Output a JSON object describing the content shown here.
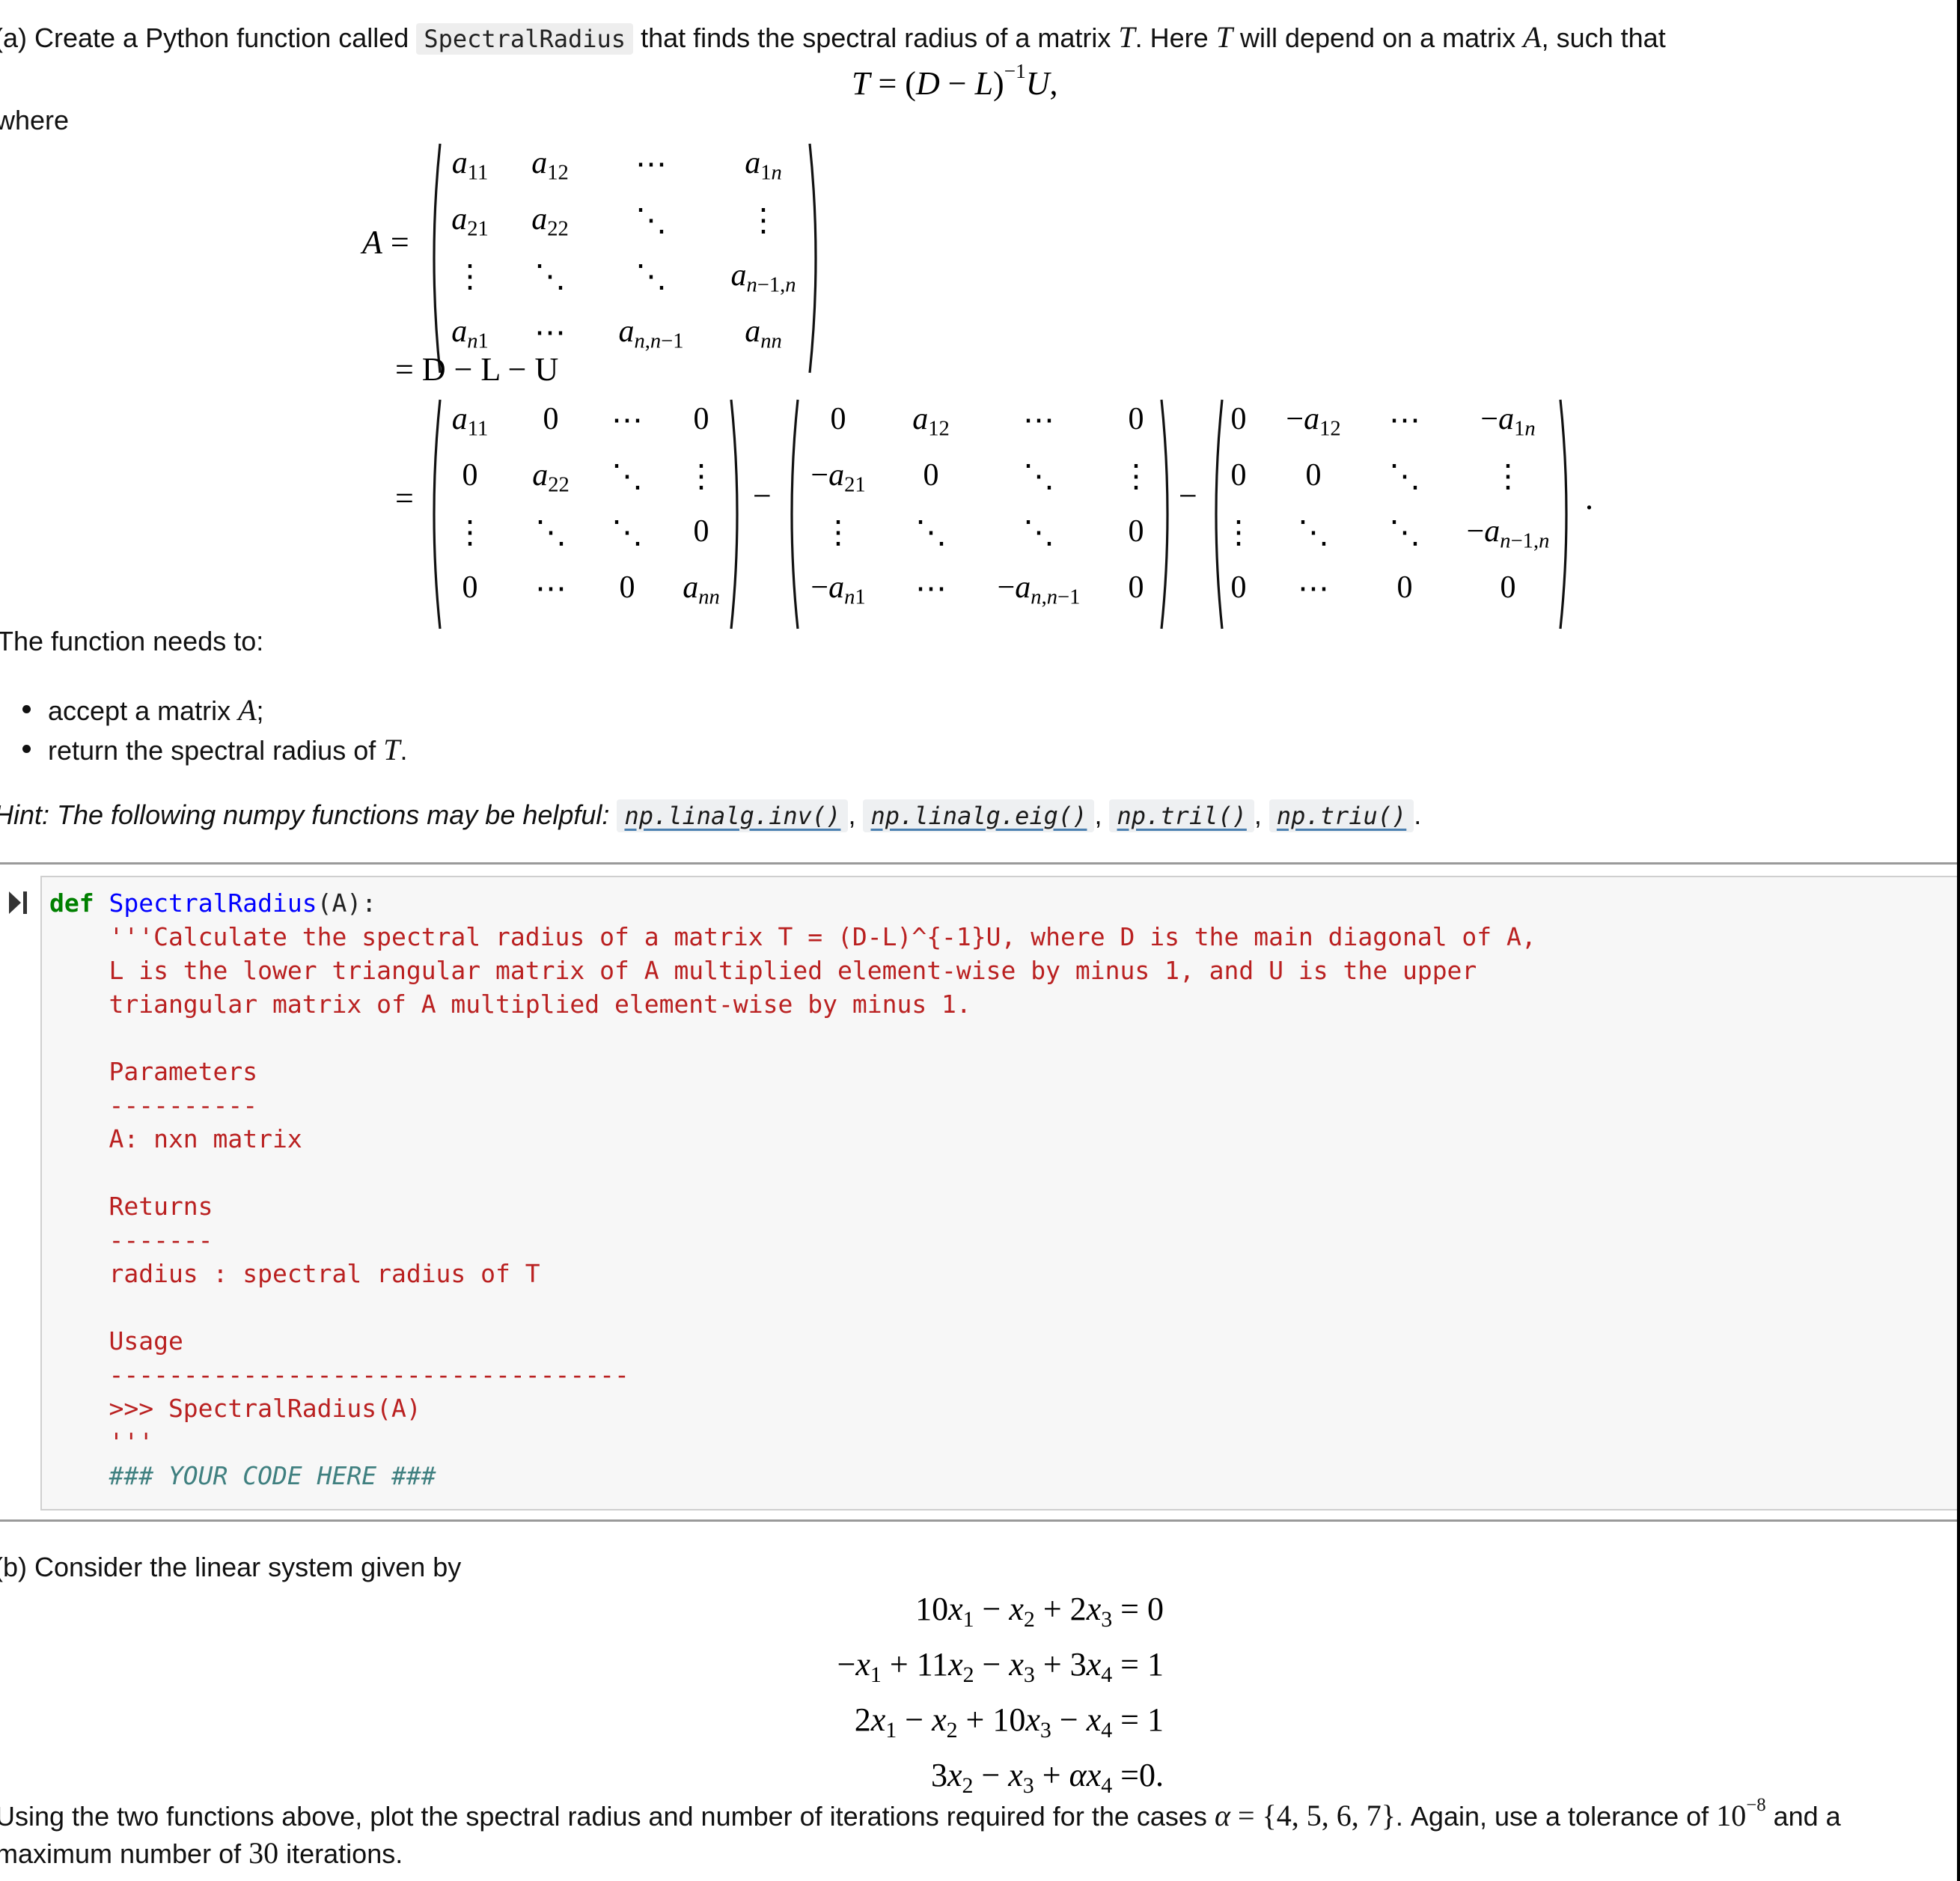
{
  "part_a": {
    "intro_before_code": "(a) Create a Python function called",
    "function_name_code": "SpectralRadius",
    "intro_after_code_1": "that finds the spectral radius of a matrix",
    "T": "T",
    "intro_after_code_2": ". Here",
    "intro_after_code_3": "will depend on a matrix",
    "A": "A",
    "intro_after_code_4": ", such that",
    "formula_T": {
      "lhs": "T",
      "eq": " = (",
      "D": "D",
      "minus": " − ",
      "L": "L",
      "close": ")",
      "exp": "−1",
      "U": "U",
      "end": ","
    },
    "where_label": "where",
    "matrix_A": {
      "label": "A",
      "eq": "=",
      "rows": [
        [
          "a11",
          "a12",
          "⋯",
          "a1n"
        ],
        [
          "a21",
          "a22",
          "⋱",
          "⋮"
        ],
        [
          "⋮",
          "⋱",
          "⋱",
          "an-1,n"
        ],
        [
          "an1",
          "⋯",
          "an,n-1",
          "ann"
        ]
      ]
    },
    "decomposition_line": "= D − L − U",
    "matrix_D": {
      "rows": [
        [
          "a11",
          "0",
          "⋯",
          "0"
        ],
        [
          "0",
          "a22",
          "⋱",
          "⋮"
        ],
        [
          "⋮",
          "⋱",
          "⋱",
          "0"
        ],
        [
          "0",
          "⋯",
          "0",
          "ann"
        ]
      ]
    },
    "matrix_L_neg": {
      "rows": [
        [
          "0",
          "a12",
          "⋯",
          "0"
        ],
        [
          "−a21",
          "0",
          "⋱",
          "⋮"
        ],
        [
          "⋮",
          "⋱",
          "⋱",
          "0"
        ],
        [
          "−an1",
          "⋯",
          "−an,n-1",
          "0"
        ]
      ]
    },
    "matrix_U_neg": {
      "rows": [
        [
          "0",
          "−a12",
          "⋯",
          "−a1n"
        ],
        [
          "0",
          "0",
          "⋱",
          "⋮"
        ],
        [
          "⋮",
          "⋱",
          "⋱",
          "−an-1,n"
        ],
        [
          "0",
          "⋯",
          "0",
          "0"
        ]
      ]
    },
    "function_needs": "The function needs to:",
    "bullets": [
      {
        "text": "accept a matrix ",
        "math": "A",
        "tail": ";"
      },
      {
        "text": "return the spectral radius of ",
        "math": "T",
        "tail": "."
      }
    ],
    "hint_prefix": "Hint: The following numpy functions may be helpful:",
    "hint_functions": [
      "np.linalg.inv()",
      "np.linalg.eig()",
      "np.tril()",
      "np.triu()"
    ],
    "hint_separators": [
      ",",
      ",",
      ",",
      "."
    ]
  },
  "code_cell": {
    "run_icon": "run-cell-icon",
    "lines": [
      {
        "kw": "def",
        "fn": "SpectralRadius",
        "plain": "(A):"
      },
      {
        "doc": "    '''Calculate the spectral radius of a matrix T = (D-L)^{-1}U, where D is the main diagonal of A,"
      },
      {
        "doc": "    L is the lower triangular matrix of A multiplied element-wise by minus 1, and U is the upper"
      },
      {
        "doc": "    triangular matrix of A multiplied element-wise by minus 1."
      },
      {
        "doc": ""
      },
      {
        "doc": "    Parameters"
      },
      {
        "doc": "    ----------"
      },
      {
        "doc": "    A: nxn matrix"
      },
      {
        "doc": ""
      },
      {
        "doc": "    Returns"
      },
      {
        "doc": "    -------"
      },
      {
        "doc": "    radius : spectral radius of T"
      },
      {
        "doc": ""
      },
      {
        "doc": "    Usage"
      },
      {
        "doc": "    -----------------------------------"
      },
      {
        "doc": "    >>> SpectralRadius(A)"
      },
      {
        "doc": "    '''"
      },
      {
        "cm": "    ### YOUR CODE HERE ###"
      }
    ]
  },
  "part_b": {
    "intro": "(b) Consider the linear system given by",
    "equations": [
      "10x₁ − x₂ + 2x₃ = 0",
      "−x₁ + 11x₂ − x₃ + 3x₄ = 1",
      "2x₁ − x₂ + 10x₃ − x₄ = 1",
      "3x₂ − x₃ + αx₄ =0."
    ],
    "closing_line1_a": "Using the two functions above, plot the spectral radius and number of iterations required for the cases",
    "alpha_set": "α = {4, 5, 6, 7}",
    "closing_line1_b": ". Again, use a tolerance of",
    "tolerance_base": "10",
    "tolerance_exp": "−8",
    "closing_line1_c": "and a",
    "closing_line2_a": "maximum number of",
    "max_iter": "30",
    "closing_line2_b": "iterations."
  }
}
